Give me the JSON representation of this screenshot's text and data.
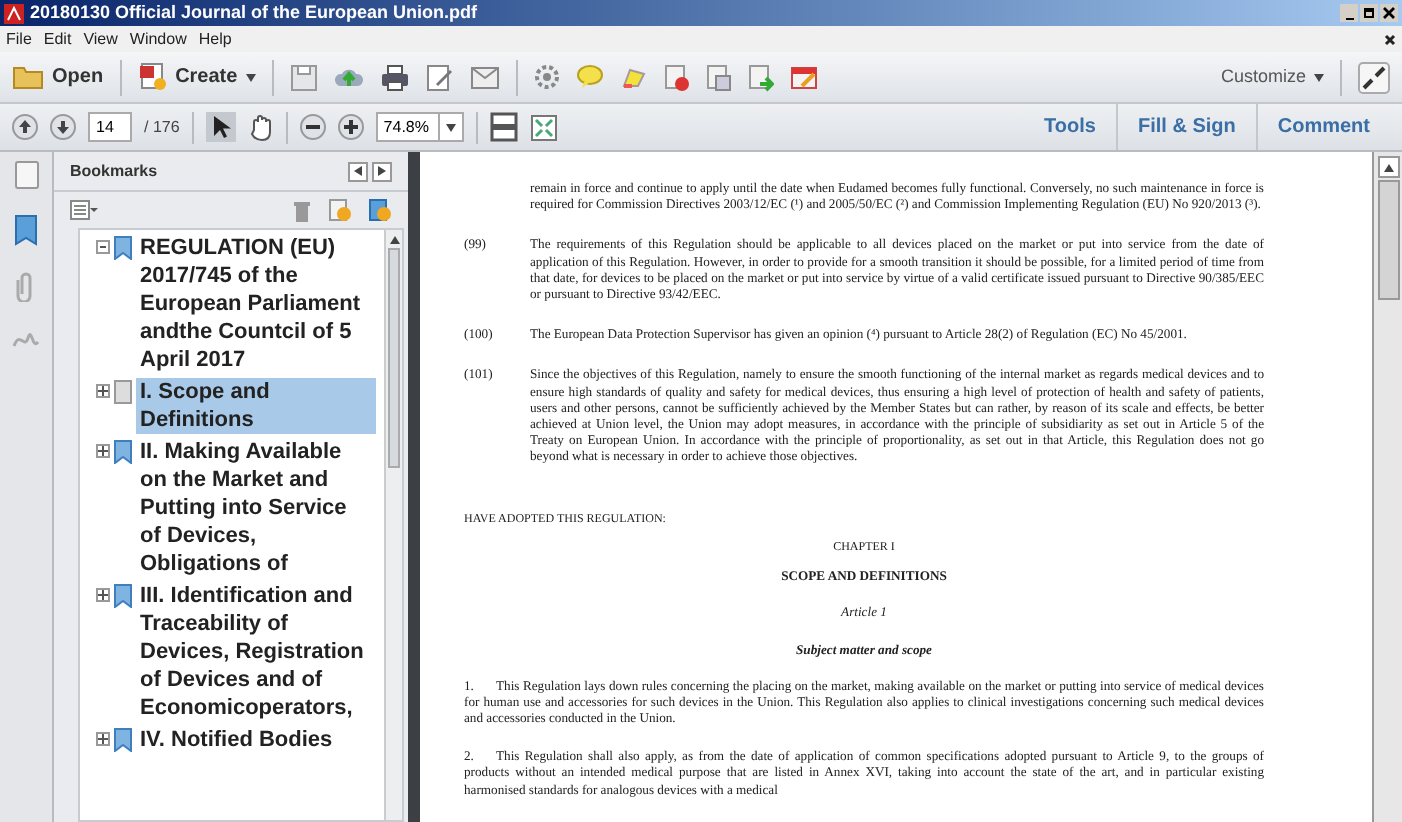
{
  "window": {
    "title": "20180130 Official Journal of the European Union.pdf"
  },
  "menu": [
    "File",
    "Edit",
    "View",
    "Window",
    "Help"
  ],
  "toolbar": {
    "open": "Open",
    "create": "Create",
    "customize": "Customize"
  },
  "navigation": {
    "page": "14",
    "total": "/ 176",
    "zoom": "74.8%"
  },
  "panel_links": [
    "Tools",
    "Fill & Sign",
    "Comment"
  ],
  "bookmarks": {
    "title": "Bookmarks",
    "tree": [
      {
        "label": "REGULATION (EU) 2017/745 of the European Parliament andthe Countcil of 5 April 2017",
        "expanded": true,
        "selected": false,
        "children": [
          {
            "label": "I. Scope and Definitions",
            "expanded": false,
            "selected": true
          },
          {
            "label": "II. Making Available on the Market and Putting into Service of Devices, Obligations of",
            "expanded": false,
            "selected": false
          },
          {
            "label": "III. Identification and Traceability of Devices, Registration of Devices and of Economicoperators,",
            "expanded": false,
            "selected": false
          },
          {
            "label": "IV. Notified Bodies",
            "expanded": false,
            "selected": false
          }
        ]
      }
    ]
  },
  "document": [
    {
      "kind": "continuation",
      "text": "remain in force and continue to apply until the date when Eudamed becomes fully functional. Conversely, no such maintenance in force is required for Commission Directives 2003/12/EC (¹) and 2005/50/EC (²) and Commission Implementing Regulation (EU) No 920/2013 (³)."
    },
    {
      "kind": "recital",
      "number": "(99)",
      "text": "The requirements of this Regulation should be applicable to all devices placed on the market or put into service from the date of application of this Regulation. However, in order to provide for a smooth transition it should be possible, for a limited period of time from that date, for devices to be placed on the market or put into service by virtue of a valid certificate issued pursuant to Directive 90/385/EEC or pursuant to Directive 93/42/EEC."
    },
    {
      "kind": "recital",
      "number": "(100)",
      "text": "The European Data Protection Supervisor has given an opinion (⁴) pursuant to Article 28(2) of Regulation (EC) No 45/2001."
    },
    {
      "kind": "recital",
      "number": "(101)",
      "text": "Since the objectives of this Regulation, namely to ensure the smooth functioning of the internal market as regards medical devices and to ensure high standards of quality and safety for medical devices, thus ensuring a high level of protection of health and safety of patients, users and other persons, cannot be sufficiently achieved by the Member States but can rather, by reason of its scale and effects, be better achieved at Union level, the Union may adopt measures, in accordance with the principle of subsidiarity as set out in Article 5 of the Treaty on European Union. In accordance with the principle of proportionality, as set out in that Article, this Regulation does not go beyond what is necessary in order to achieve those objectives."
    },
    {
      "kind": "plain",
      "text": "HAVE ADOPTED THIS REGULATION:"
    },
    {
      "kind": "center",
      "text": "CHAPTER I"
    },
    {
      "kind": "center-bold",
      "text": "SCOPE AND DEFINITIONS"
    },
    {
      "kind": "center-italic",
      "text": "Article 1"
    },
    {
      "kind": "center-bold-italic",
      "text": "Subject matter and scope"
    },
    {
      "kind": "numbered",
      "number": "1.",
      "text": "This Regulation lays down rules concerning the placing on the market, making available on the market or putting into service of medical devices for human use and accessories for such devices in the Union. This Regulation also applies to clinical investigations concerning such medical devices and accessories conducted in the Union."
    },
    {
      "kind": "numbered",
      "number": "2.",
      "text": "This Regulation shall also apply, as from the date of application of common specifications adopted pursuant to Article 9, to the groups of products without an intended medical purpose that are listed in Annex XVI, taking into account the state of the art, and in particular existing harmonised standards for analogous devices with a medical"
    }
  ]
}
